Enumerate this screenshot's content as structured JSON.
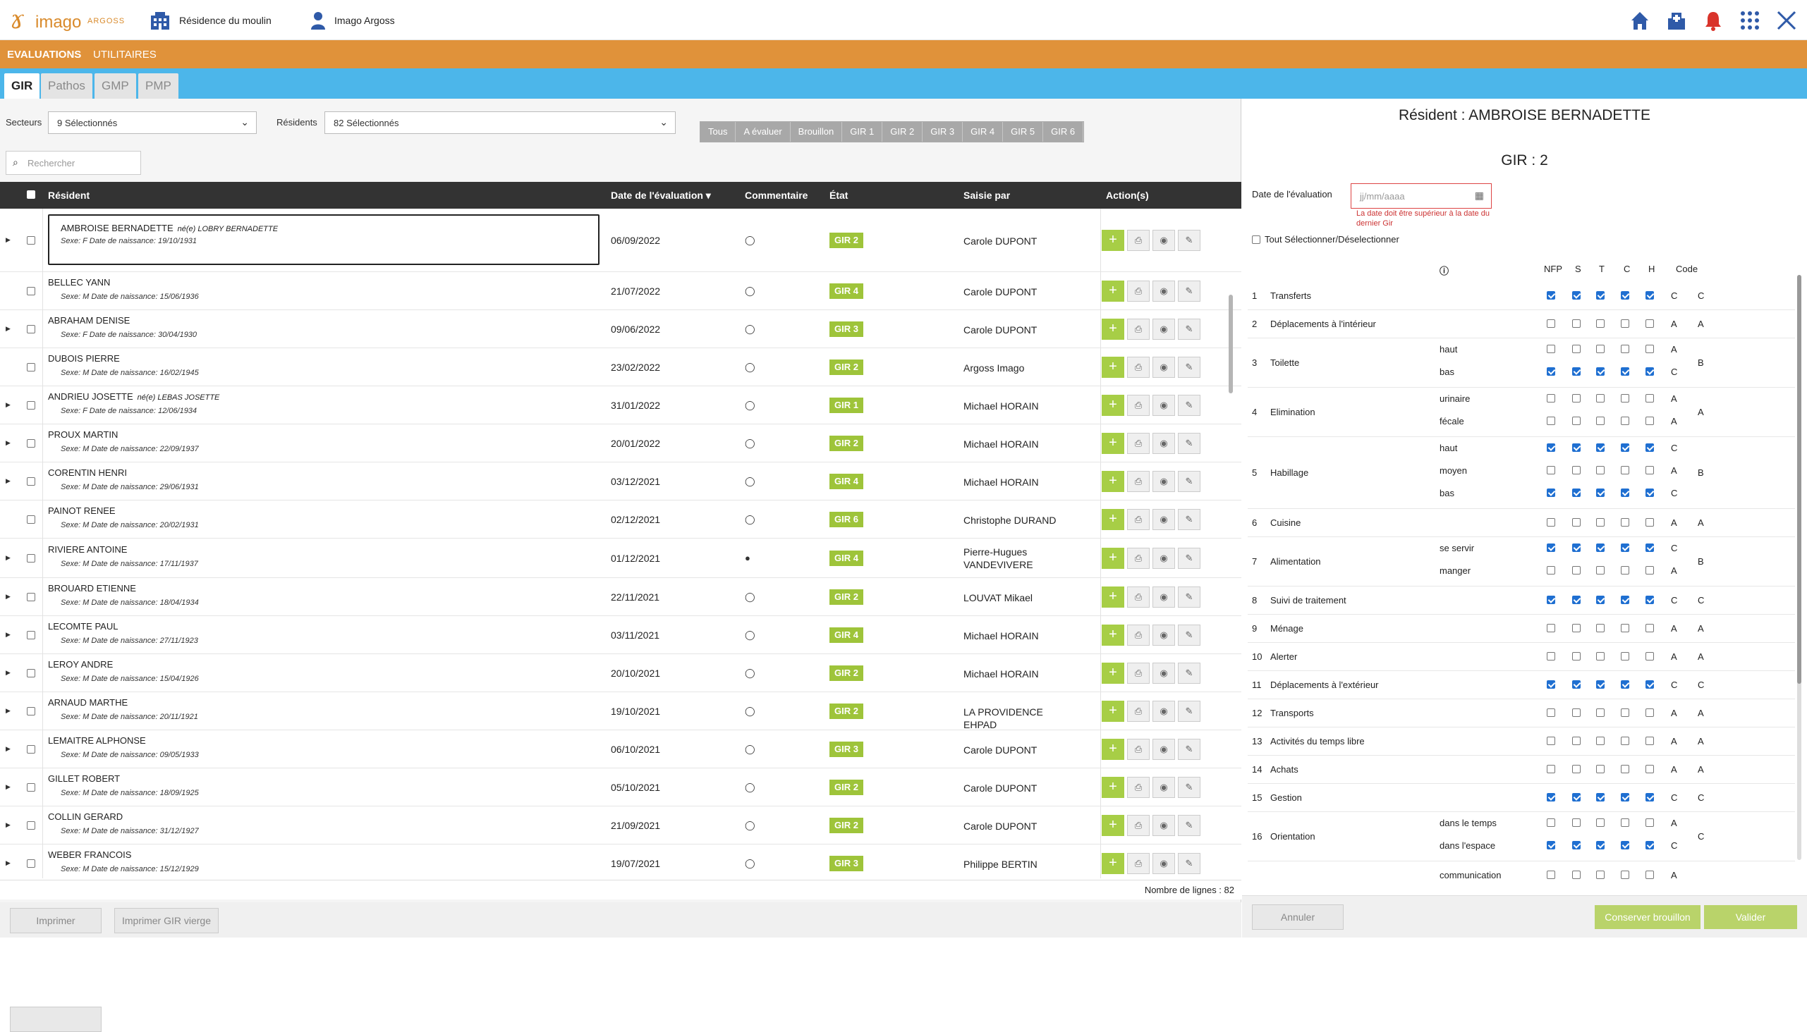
{
  "app": {
    "logo_text": "imago",
    "logo_sub": "ARGOSS",
    "residence": "Résidence du moulin",
    "user": "Imago Argoss"
  },
  "nav": {
    "items": [
      "EVALUATIONS",
      "UTILITAIRES"
    ]
  },
  "tabs": [
    "GIR",
    "Pathos",
    "GMP",
    "PMP"
  ],
  "filters": {
    "secteurs_label": "Secteurs",
    "secteurs_value": "9 Sélectionnés",
    "residents_label": "Résidents",
    "residents_value": "82 Sélectionnés",
    "status_buttons": [
      "Tous",
      "A évaluer",
      "Brouillon",
      "GIR 1",
      "GIR 2",
      "GIR 3",
      "GIR 4",
      "GIR 5",
      "GIR 6"
    ]
  },
  "search": {
    "placeholder": "Rechercher"
  },
  "table": {
    "headers": [
      "Résident",
      "Date de l'évaluation ▾",
      "Commentaire",
      "État",
      "Saisie par",
      "Action(s)"
    ],
    "rows": [
      {
        "name": "AMBROISE BERNADETTE",
        "nee": "né(e) LOBRY BERNADETTE",
        "sub": "Sexe: F  Date de naissance: 19/10/1931",
        "date": "06/09/2022",
        "gir": "GIR 2",
        "by": "Carole DUPONT",
        "arrow": true
      },
      {
        "name": "BELLEC YANN",
        "nee": "",
        "sub": "Sexe: M  Date de naissance: 15/06/1936",
        "date": "21/07/2022",
        "gir": "GIR 4",
        "by": "Carole DUPONT",
        "arrow": false
      },
      {
        "name": "ABRAHAM DENISE",
        "nee": "",
        "sub": "Sexe: F  Date de naissance: 30/04/1930",
        "date": "09/06/2022",
        "gir": "GIR 3",
        "by": "Carole DUPONT",
        "arrow": true
      },
      {
        "name": "DUBOIS PIERRE",
        "nee": "",
        "sub": "Sexe: M  Date de naissance: 16/02/1945",
        "date": "23/02/2022",
        "gir": "GIR 2",
        "by": "Argoss Imago",
        "arrow": false
      },
      {
        "name": "ANDRIEU JOSETTE",
        "nee": "né(e) LEBAS JOSETTE",
        "sub": "Sexe: F  Date de naissance: 12/06/1934",
        "date": "31/01/2022",
        "gir": "GIR 1",
        "by": "Michael HORAIN",
        "arrow": true
      },
      {
        "name": "PROUX MARTIN",
        "nee": "",
        "sub": "Sexe: M  Date de naissance: 22/09/1937",
        "date": "20/01/2022",
        "gir": "GIR 2",
        "by": "Michael HORAIN",
        "arrow": true
      },
      {
        "name": "CORENTIN HENRI",
        "nee": "",
        "sub": "Sexe: M  Date de naissance: 29/06/1931",
        "date": "03/12/2021",
        "gir": "GIR 4",
        "by": "Michael HORAIN",
        "arrow": true
      },
      {
        "name": "PAINOT RENEE",
        "nee": "",
        "sub": "Sexe: M  Date de naissance: 20/02/1931",
        "date": "02/12/2021",
        "gir": "GIR 6",
        "by": "Christophe DURAND",
        "arrow": false
      },
      {
        "name": "RIVIERE ANTOINE",
        "nee": "",
        "sub": "Sexe: M  Date de naissance: 17/11/1937",
        "date": "01/12/2021",
        "gir": "GIR 4",
        "by": "Pierre-Hugues VANDEVIVERE",
        "arrow": true
      },
      {
        "name": "BROUARD ETIENNE",
        "nee": "",
        "sub": "Sexe: M  Date de naissance: 18/04/1934",
        "date": "22/11/2021",
        "gir": "GIR 2",
        "by": "LOUVAT Mikael",
        "arrow": true
      },
      {
        "name": "LECOMTE PAUL",
        "nee": "",
        "sub": "Sexe: M  Date de naissance: 27/11/1923",
        "date": "03/11/2021",
        "gir": "GIR 4",
        "by": "Michael HORAIN",
        "arrow": true
      },
      {
        "name": "LEROY ANDRE",
        "nee": "",
        "sub": "Sexe: M  Date de naissance: 15/04/1926",
        "date": "20/10/2021",
        "gir": "GIR 2",
        "by": "Michael HORAIN",
        "arrow": true
      },
      {
        "name": "ARNAUD MARTHE",
        "nee": "",
        "sub": "Sexe: M  Date de naissance: 20/11/1921",
        "date": "19/10/2021",
        "gir": "GIR 2",
        "by": "LA PROVIDENCE EHPAD",
        "arrow": true
      },
      {
        "name": "LEMAITRE ALPHONSE",
        "nee": "",
        "sub": "Sexe: M  Date de naissance: 09/05/1933",
        "date": "06/10/2021",
        "gir": "GIR 3",
        "by": "Carole DUPONT",
        "arrow": true
      },
      {
        "name": "GILLET ROBERT",
        "nee": "",
        "sub": "Sexe: M  Date de naissance: 18/09/1925",
        "date": "05/10/2021",
        "gir": "GIR 2",
        "by": "Carole DUPONT",
        "arrow": true
      },
      {
        "name": "COLLIN GERARD",
        "nee": "",
        "sub": "Sexe: M  Date de naissance: 31/12/1927",
        "date": "21/09/2021",
        "gir": "GIR 2",
        "by": "Carole DUPONT",
        "arrow": true
      },
      {
        "name": "WEBER FRANCOIS",
        "nee": "",
        "sub": "Sexe: M  Date de naissance: 15/12/1929",
        "date": "19/07/2021",
        "gir": "GIR 3",
        "by": "Philippe BERTIN",
        "arrow": true
      }
    ],
    "line_count": "Nombre de lignes : 82"
  },
  "left_buttons": {
    "print": "Imprimer",
    "print_blank": "Imprimer GIR vierge"
  },
  "panel": {
    "resident_title": "Résident : AMBROISE BERNADETTE",
    "gir_title": "GIR : 2",
    "date_label": "Date de l'évaluation",
    "date_placeholder": "jj/mm/aaaa",
    "date_error": "La date doit être supérieur à la date du dernier Gir",
    "select_all": "Tout Sélectionner/Déselectionner",
    "col_headers": [
      "NFP",
      "S",
      "T",
      "C",
      "H",
      "Code"
    ],
    "items": [
      {
        "num": "1",
        "label": "Transferts",
        "subs": [
          {
            "sub": "",
            "checks": [
              1,
              1,
              1,
              1,
              1
            ],
            "val": "C"
          }
        ],
        "code": "C"
      },
      {
        "num": "2",
        "label": "Déplacements à l'intérieur",
        "subs": [
          {
            "sub": "",
            "checks": [
              0,
              0,
              0,
              0,
              0
            ],
            "val": "A"
          }
        ],
        "code": "A"
      },
      {
        "num": "3",
        "label": "Toilette",
        "subs": [
          {
            "sub": "haut",
            "checks": [
              0,
              0,
              0,
              0,
              0
            ],
            "val": "A"
          },
          {
            "sub": "bas",
            "checks": [
              1,
              1,
              1,
              1,
              1
            ],
            "val": "C"
          }
        ],
        "code": "B"
      },
      {
        "num": "4",
        "label": "Elimination",
        "subs": [
          {
            "sub": "urinaire",
            "checks": [
              0,
              0,
              0,
              0,
              0
            ],
            "val": "A"
          },
          {
            "sub": "fécale",
            "checks": [
              0,
              0,
              0,
              0,
              0
            ],
            "val": "A"
          }
        ],
        "code": "A"
      },
      {
        "num": "5",
        "label": "Habillage",
        "subs": [
          {
            "sub": "haut",
            "checks": [
              1,
              1,
              1,
              1,
              1
            ],
            "val": "C"
          },
          {
            "sub": "moyen",
            "checks": [
              0,
              0,
              0,
              0,
              0
            ],
            "val": "A"
          },
          {
            "sub": "bas",
            "checks": [
              1,
              1,
              1,
              1,
              1
            ],
            "val": "C"
          }
        ],
        "code": "B"
      },
      {
        "num": "6",
        "label": "Cuisine",
        "subs": [
          {
            "sub": "",
            "checks": [
              0,
              0,
              0,
              0,
              0
            ],
            "val": "A"
          }
        ],
        "code": "A"
      },
      {
        "num": "7",
        "label": "Alimentation",
        "subs": [
          {
            "sub": "se servir",
            "checks": [
              1,
              1,
              1,
              1,
              1
            ],
            "val": "C"
          },
          {
            "sub": "manger",
            "checks": [
              0,
              0,
              0,
              0,
              0
            ],
            "val": "A"
          }
        ],
        "code": "B"
      },
      {
        "num": "8",
        "label": "Suivi de traitement",
        "subs": [
          {
            "sub": "",
            "checks": [
              1,
              1,
              1,
              1,
              1
            ],
            "val": "C"
          }
        ],
        "code": "C"
      },
      {
        "num": "9",
        "label": "Ménage",
        "subs": [
          {
            "sub": "",
            "checks": [
              0,
              0,
              0,
              0,
              0
            ],
            "val": "A"
          }
        ],
        "code": "A"
      },
      {
        "num": "10",
        "label": "Alerter",
        "subs": [
          {
            "sub": "",
            "checks": [
              0,
              0,
              0,
              0,
              0
            ],
            "val": "A"
          }
        ],
        "code": "A"
      },
      {
        "num": "11",
        "label": "Déplacements à l'extérieur",
        "subs": [
          {
            "sub": "",
            "checks": [
              1,
              1,
              1,
              1,
              1
            ],
            "val": "C"
          }
        ],
        "code": "C"
      },
      {
        "num": "12",
        "label": "Transports",
        "subs": [
          {
            "sub": "",
            "checks": [
              0,
              0,
              0,
              0,
              0
            ],
            "val": "A"
          }
        ],
        "code": "A"
      },
      {
        "num": "13",
        "label": "Activités du temps libre",
        "subs": [
          {
            "sub": "",
            "checks": [
              0,
              0,
              0,
              0,
              0
            ],
            "val": "A"
          }
        ],
        "code": "A"
      },
      {
        "num": "14",
        "label": "Achats",
        "subs": [
          {
            "sub": "",
            "checks": [
              0,
              0,
              0,
              0,
              0
            ],
            "val": "A"
          }
        ],
        "code": "A"
      },
      {
        "num": "15",
        "label": "Gestion",
        "subs": [
          {
            "sub": "",
            "checks": [
              1,
              1,
              1,
              1,
              1
            ],
            "val": "C"
          }
        ],
        "code": "C"
      },
      {
        "num": "16",
        "label": "Orientation",
        "subs": [
          {
            "sub": "dans le temps",
            "checks": [
              0,
              0,
              0,
              0,
              0
            ],
            "val": "A"
          },
          {
            "sub": "dans l'espace",
            "checks": [
              1,
              1,
              1,
              1,
              1
            ],
            "val": "C"
          }
        ],
        "code": "C"
      },
      {
        "num": "",
        "label": "",
        "subs": [
          {
            "sub": "communication",
            "checks": [
              0,
              0,
              0,
              0,
              0
            ],
            "val": "A"
          }
        ],
        "code": ""
      }
    ],
    "buttons": {
      "cancel": "Annuler",
      "save_draft": "Conserver brouillon",
      "validate": "Valider"
    }
  },
  "colors": {
    "orange": "#e0923a",
    "blue": "#4cb6ea",
    "gir_green": "#9ec43a",
    "icon_blue": "#2f5aa8"
  }
}
